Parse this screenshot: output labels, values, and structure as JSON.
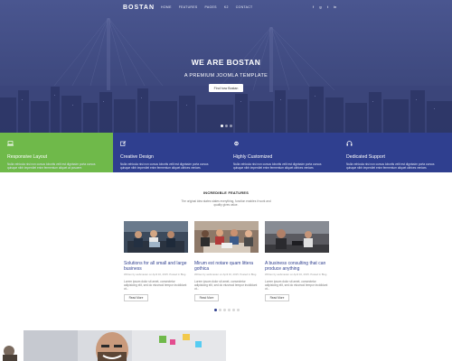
{
  "brand": {
    "logo": "BOSTAN"
  },
  "nav": {
    "items": [
      "HOME",
      "FEATURES",
      "PAGES",
      "K2",
      "CONTACT"
    ],
    "social_icons": [
      "facebook-icon",
      "google-plus-icon",
      "twitter-icon",
      "linkedin-icon"
    ],
    "social_glyphs": [
      "f",
      "g",
      "t",
      "in"
    ]
  },
  "hero": {
    "title": "WE ARE BOSTAN",
    "subtitle": "A PREMIUM JOOMLA TEMPLATE",
    "button": "Find how Bostan",
    "slides": 3,
    "active_slide": 0
  },
  "features": [
    {
      "icon": "laptop-icon",
      "title": "Responsive Layout",
      "text": "Nulla vehicula nisi non cursus lobortis velit est dignissim porta cursus quisque nibh imperdiet enim fermentum aliquet at posuere.",
      "color": "#6fb94a"
    },
    {
      "icon": "edit-icon",
      "title": "Creative Design",
      "text": "Nulla vehicula nisi non cursus lobortis velit est dignissim porta cursus quisque nibh imperdiet enim fermentum aliquet ultrices veniam.",
      "color": "#2f3f8f"
    },
    {
      "icon": "gear-icon",
      "title": "Highly Customized",
      "text": "Nulla vehicula nisi non cursus lobortis velit est dignissim porta cursus quisque nibh imperdiet enim fermentum aliquet ultrices veniam.",
      "color": "#2f3f8f"
    },
    {
      "icon": "headset-icon",
      "title": "Dedicated Support",
      "text": "Nulla vehicula nisi non cursus lobortis velit est dignissim porta cursus quisque nibh imperdiet enim fermentum aliquet ultrices veniam.",
      "color": "#2f3f8f"
    }
  ],
  "incredible": {
    "title": "INCREDIBLE FEATURES",
    "description": "The original idea states states everything, function enables it work and quality gives value."
  },
  "cards": [
    {
      "title": "Solutions for all small and large business",
      "meta": "Written by webmaster on April 16, 2015. Posted in Blog.",
      "text": "Lorem ipsum dolor sit amet, consectetur adipisicing elit, sed do eiusmod tempor incididunt ut...",
      "button": "Read More"
    },
    {
      "title": "Mirum est notare quam littera gothica",
      "meta": "Written by webmaster on April 16, 2015. Posted in Blog.",
      "text": "Lorem ipsum dolor sit amet, consectetur adipisicing elit, sed do eiusmod tempor incididunt ut...",
      "button": "Read More"
    },
    {
      "title": "A business consulting that can produce anything",
      "meta": "Written by webmaster on April 16, 2015. Posted in Blog.",
      "text": "Lorem ipsum dolor sit amet, consectetur adipisicing elit, sed do eiusmod tempor incididunt ut...",
      "button": "Read More"
    }
  ],
  "card_slider": {
    "dots": 6,
    "active": 0
  },
  "colors": {
    "brand_blue": "#2f3f8f",
    "brand_green": "#6fb94a",
    "hero_bg": "#414c86"
  }
}
